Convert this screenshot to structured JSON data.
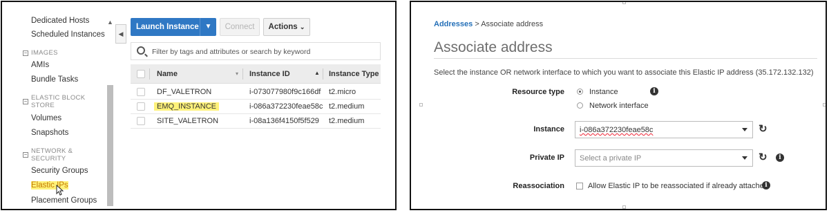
{
  "left_panel": {
    "sidebar": {
      "items_top": [
        "Dedicated Hosts",
        "Scheduled Instances"
      ],
      "images_heading": "IMAGES",
      "images_items": [
        "AMIs",
        "Bundle Tasks"
      ],
      "ebs_heading_1": "ELASTIC BLOCK",
      "ebs_heading_2": "STORE",
      "ebs_items": [
        "Volumes",
        "Snapshots"
      ],
      "net_heading_1": "NETWORK &",
      "net_heading_2": "SECURITY",
      "net_items": [
        "Security Groups",
        "Elastic IPs",
        "Placement Groups"
      ]
    },
    "toolbar": {
      "launch_label": "Launch Instance",
      "connect_label": "Connect",
      "actions_label": "Actions"
    },
    "search": {
      "placeholder": "Filter by tags and attributes or search by keyword"
    },
    "table": {
      "columns": [
        "Name",
        "Instance ID",
        "Instance Type"
      ],
      "rows": [
        {
          "name": "DF_VALETRON",
          "instance_id": "i-073077980f9c166df",
          "type": "t2.micro"
        },
        {
          "name": "EMQ_INSTANCE",
          "instance_id": "i-086a372230feae58c",
          "type": "t2.medium"
        },
        {
          "name": "SITE_VALETRON",
          "instance_id": "i-08a136f4150f5f529",
          "type": "t2.medium"
        }
      ]
    }
  },
  "right_panel": {
    "breadcrumb": {
      "link": "Addresses",
      "separator": ">",
      "current": "Associate address"
    },
    "title": "Associate address",
    "description": "Select the instance OR network interface to which you want to associate this Elastic IP address (35.172.132.132)",
    "resource_type": {
      "label": "Resource type",
      "options": [
        "Instance",
        "Network interface"
      ],
      "selected": "Instance"
    },
    "instance": {
      "label": "Instance",
      "value": "i-086a372230feae58c"
    },
    "private_ip": {
      "label": "Private IP",
      "placeholder": "Select a private IP"
    },
    "reassociation": {
      "label": "Reassociation",
      "checkbox_label": "Allow Elastic IP to be reassociated if already attached",
      "checked": false
    }
  },
  "colors": {
    "launch_button": "#2f78c4",
    "link": "#2570b8",
    "highlight": "#fff27a"
  }
}
